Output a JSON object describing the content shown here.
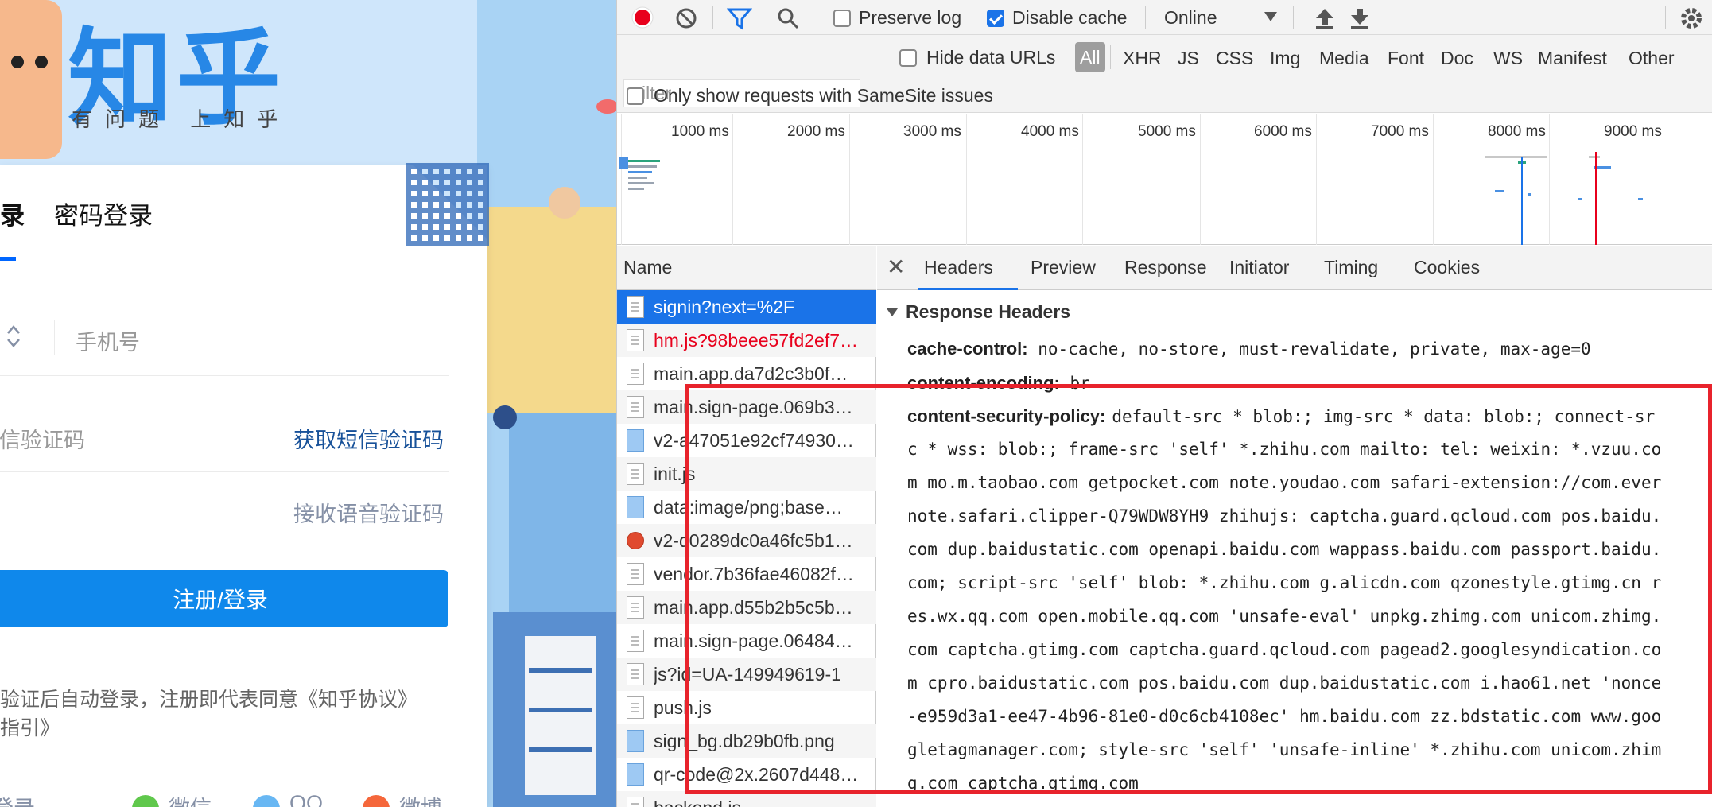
{
  "zhihu": {
    "logo": "知乎",
    "slogan": "有问题 上知乎",
    "tab_active": "录",
    "tab_password": "密码登录",
    "phone_placeholder": "手机号",
    "sms_placeholder": "短信验证码",
    "get_sms_code": "获取短信验证码",
    "voice_code": "接收语音验证码",
    "submit": "注册/登录",
    "agreement": "验证后自动登录，注册即代表同意《知乎协议》\n指引》",
    "social_login": "登录",
    "social_wechat": "微信",
    "social_qq": "QQ",
    "social_weibo": "微博",
    "colors": {
      "brand": "#0f88eb",
      "link": "#175199"
    }
  },
  "devtools": {
    "toolbar": {
      "preserve_log": "Preserve log",
      "preserve_log_checked": false,
      "disable_cache": "Disable cache",
      "disable_cache_checked": true,
      "throttle": "Online",
      "icons": [
        "record-icon",
        "clear-icon",
        "filter-icon",
        "search-icon",
        "upload-icon",
        "download-icon",
        "settings-icon"
      ]
    },
    "filter": {
      "placeholder": "Filter",
      "hide_data_urls": "Hide data URLs",
      "types": [
        "All",
        "XHR",
        "JS",
        "CSS",
        "Img",
        "Media",
        "Font",
        "Doc",
        "WS",
        "Manifest",
        "Other"
      ],
      "samesite": "Only show requests with SameSite issues"
    },
    "timeline": {
      "labels": [
        "1000 ms",
        "2000 ms",
        "3000 ms",
        "4000 ms",
        "5000 ms",
        "6000 ms",
        "7000 ms",
        "8000 ms",
        "9000 ms"
      ]
    },
    "requests": {
      "header": "Name",
      "rows": [
        {
          "name": "signin?next=%2F",
          "type": "doc",
          "state": "selected"
        },
        {
          "name": "hm.js?98beee57fd2ef7…",
          "type": "doc",
          "state": "error"
        },
        {
          "name": "main.app.da7d2c3b0f…",
          "type": "doc",
          "state": ""
        },
        {
          "name": "main.sign-page.069b3…",
          "type": "doc",
          "state": ""
        },
        {
          "name": "v2-a47051e92cf74930…",
          "type": "img",
          "state": ""
        },
        {
          "name": "init.js",
          "type": "doc",
          "state": ""
        },
        {
          "name": "data:image/png;base…",
          "type": "img",
          "state": ""
        },
        {
          "name": "v2-d0289dc0a46fc5b1…",
          "type": "fav",
          "state": ""
        },
        {
          "name": "vendor.7b36fae46082f…",
          "type": "doc",
          "state": ""
        },
        {
          "name": "main.app.d55b2b5c5b…",
          "type": "doc",
          "state": ""
        },
        {
          "name": "main.sign-page.06484…",
          "type": "doc",
          "state": ""
        },
        {
          "name": "js?id=UA-149949619-1",
          "type": "doc",
          "state": ""
        },
        {
          "name": "push.js",
          "type": "doc",
          "state": ""
        },
        {
          "name": "sign_bg.db29b0fb.png",
          "type": "img",
          "state": ""
        },
        {
          "name": "qr-code@2x.2607d448…",
          "type": "img",
          "state": ""
        },
        {
          "name": "backend.js",
          "type": "doc",
          "state": ""
        }
      ]
    },
    "detail": {
      "tabs": [
        "Headers",
        "Preview",
        "Response",
        "Initiator",
        "Timing",
        "Cookies"
      ],
      "active_tab": "Headers",
      "section": "Response Headers",
      "cache_control_key": "cache-control:",
      "cache_control_val": "no-cache, no-store, must-revalidate, private, max-age=0",
      "content_encoding_key": "content-encoding:",
      "content_encoding_val": "br",
      "csp_key": "content-security-policy:",
      "csp_lines": [
        "default-src * blob:; img-src * data: blob:; connect-sr",
        "c * wss: blob:; frame-src 'self' *.zhihu.com mailto: tel: weixin: *.vzuu.co",
        "m mo.m.taobao.com getpocket.com note.youdao.com safari-extension://com.ever",
        "note.safari.clipper-Q79WDW8YH9 zhihujs: captcha.guard.qcloud.com pos.baidu.",
        "com dup.baidustatic.com openapi.baidu.com wappass.baidu.com passport.baidu.",
        "com; script-src 'self' blob: *.zhihu.com g.alicdn.com qzonestyle.gtimg.cn r",
        "es.wx.qq.com open.mobile.qq.com 'unsafe-eval' unpkg.zhimg.com unicom.zhimg.",
        "com captcha.gtimg.com captcha.guard.qcloud.com pagead2.googlesyndication.co",
        "m cpro.baidustatic.com pos.baidu.com dup.baidustatic.com i.hao61.net 'nonce",
        "-e959d3a1-ee47-4b96-81e0-d0c6cb4108ec' hm.baidu.com zz.bdstatic.com www.goo",
        "gletagmanager.com; style-src 'self' 'unsafe-inline' *.zhihu.com unicom.zhim",
        "g.com captcha.gtimg.com"
      ],
      "highlight_color": "#e8232c"
    }
  }
}
